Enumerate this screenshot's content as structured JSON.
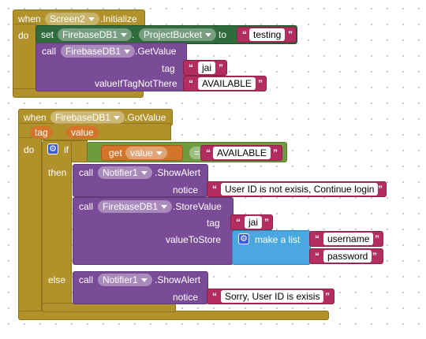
{
  "block1": {
    "when_kw": "when",
    "component": "Screen2",
    "event": ".Initialize",
    "do_kw": "do",
    "set_kw": "set",
    "set_component": "FirebaseDB1",
    "dot": ".",
    "property": "ProjectBucket",
    "to_kw": "to",
    "set_value": "testing",
    "call_kw": "call",
    "call_component": "FirebaseDB1",
    "call_method": ".GetValue",
    "tag_label": "tag",
    "tag_value": "jai",
    "vitnt_label": "valueIfTagNotThere",
    "vitnt_value": "AVAILABLE"
  },
  "block2": {
    "when_kw": "when",
    "component": "FirebaseDB1",
    "event": ".GotValue",
    "param1": "tag",
    "param2": "value",
    "do_kw": "do",
    "if_kw": "if",
    "get_kw": "get",
    "get_var": "value",
    "op": "=",
    "compare_value": "AVAILABLE",
    "then_kw": "then",
    "then_call": {
      "call_kw": "call",
      "component": "Notifier1",
      "method": ".ShowAlert",
      "notice_label": "notice",
      "notice_value": "User ID is not exisis, Continue login"
    },
    "store_call": {
      "call_kw": "call",
      "component": "FirebaseDB1",
      "method": ".StoreValue",
      "tag_label": "tag",
      "tag_value": "jai",
      "vts_label": "valueToStore",
      "make_list": "make a list",
      "items": [
        "username",
        "password"
      ]
    },
    "else_kw": "else",
    "else_call": {
      "call_kw": "call",
      "component": "Notifier1",
      "method": ".ShowAlert",
      "notice_label": "notice",
      "notice_value": "Sorry, User ID is exisis"
    }
  },
  "quote_open": "“",
  "quote_close": "”",
  "icons": {
    "mutator": "gear-icon",
    "dropdown": "chevron-down-icon"
  },
  "colors": {
    "event": "#b1922a",
    "procedure": "#7a4c97",
    "setter": "#2f6b3d",
    "logic": "#6f9b3f",
    "variable": "#d2752b",
    "text": "#b32d5e",
    "list": "#4aa7df",
    "mutator": "#3b5bd6"
  }
}
